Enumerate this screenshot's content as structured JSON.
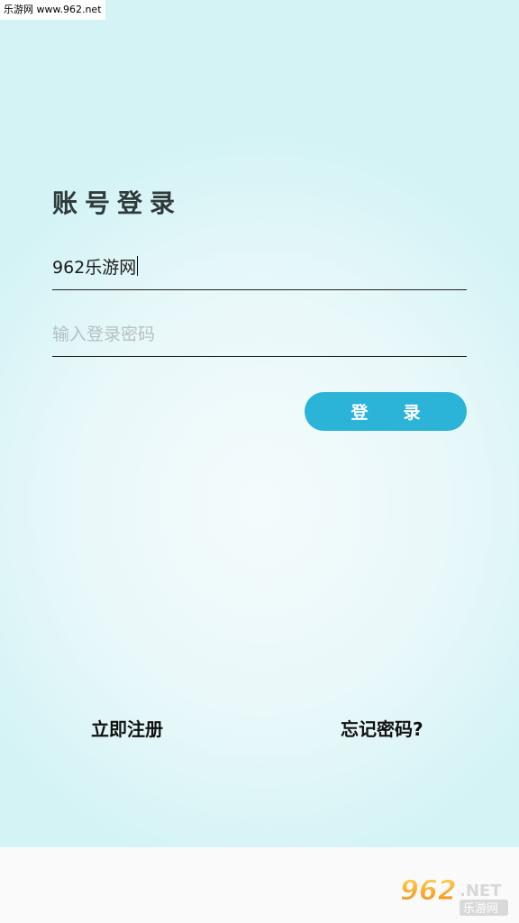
{
  "watermark_top": "乐游网 www.962.net",
  "form": {
    "title": "账号登录",
    "username_value": "962乐游网",
    "password_placeholder": "输入登录密码",
    "login_button_chars": [
      "登",
      "录"
    ]
  },
  "links": {
    "register": "立即注册",
    "forgot": "忘记密码?"
  },
  "logo": {
    "text_main": "962",
    "text_suffix": ".NET",
    "text_sub": "乐游网"
  },
  "colors": {
    "accent": "#2bb3d8",
    "background_top": "#d3f3f5",
    "title_text": "#2f3b3b"
  }
}
